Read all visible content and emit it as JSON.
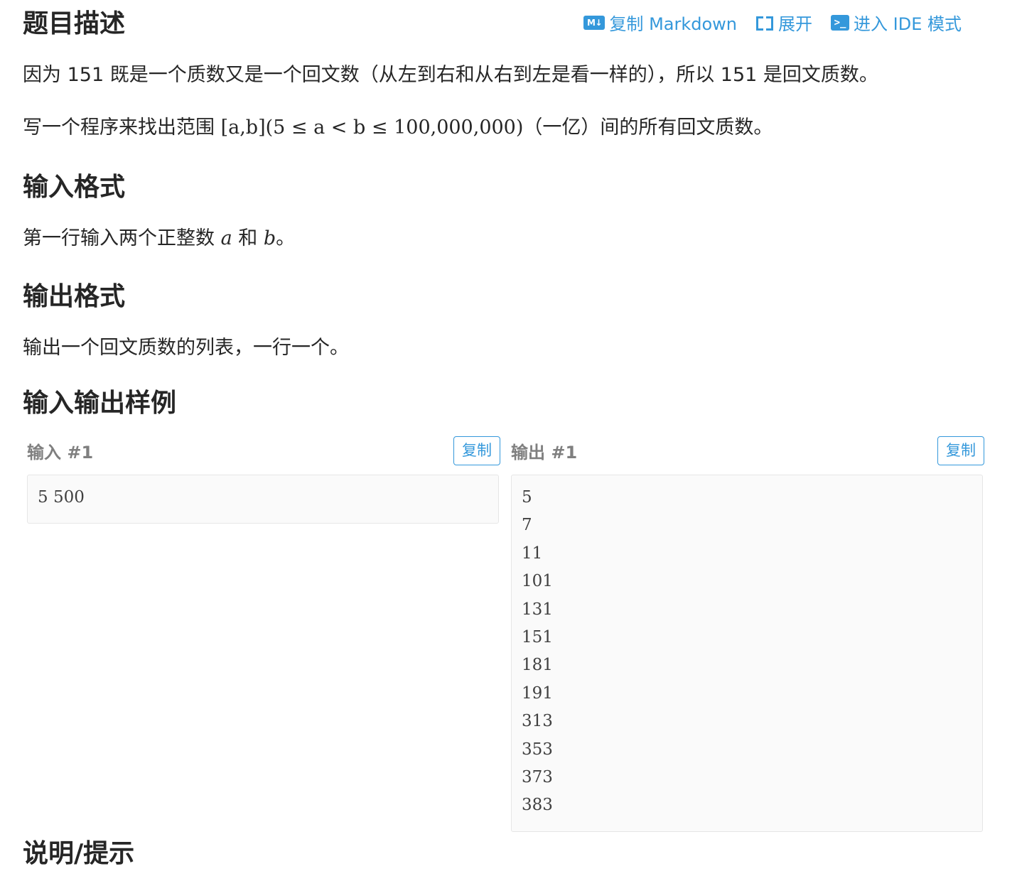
{
  "toolbar": {
    "copy_markdown": "复制 Markdown",
    "expand": "展开",
    "ide_mode": "进入 IDE 模式",
    "md_icon_text": "M↓",
    "ide_icon_text": ">_"
  },
  "description": {
    "heading": "题目描述",
    "para1": "因为 151 既是一个质数又是一个回文数（从左到右和从右到左是看一样的），所以 151 是回文质数。",
    "para2_prefix": "写一个程序来找出范围 ",
    "para2_math": "[a,b](5 ≤ a < b ≤ 100,000,000)",
    "para2_suffix": "（一亿）间的所有回文质数。"
  },
  "input_format": {
    "heading": "输入格式",
    "text_prefix": "第一行输入两个正整数 ",
    "var_a": "a",
    "text_mid": " 和 ",
    "var_b": "b",
    "text_suffix": "。"
  },
  "output_format": {
    "heading": "输出格式",
    "text": "输出一个回文质数的列表，一行一个。"
  },
  "samples": {
    "heading": "输入输出样例",
    "input_title": "输入 #1",
    "output_title": "输出 #1",
    "copy_label": "复制",
    "input_lines": [
      "5 500"
    ],
    "output_lines": [
      "5",
      "7",
      "11",
      "101",
      "131",
      "151",
      "181",
      "191",
      "313",
      "353",
      "373",
      "383"
    ]
  },
  "hint": {
    "heading": "说明/提示"
  }
}
